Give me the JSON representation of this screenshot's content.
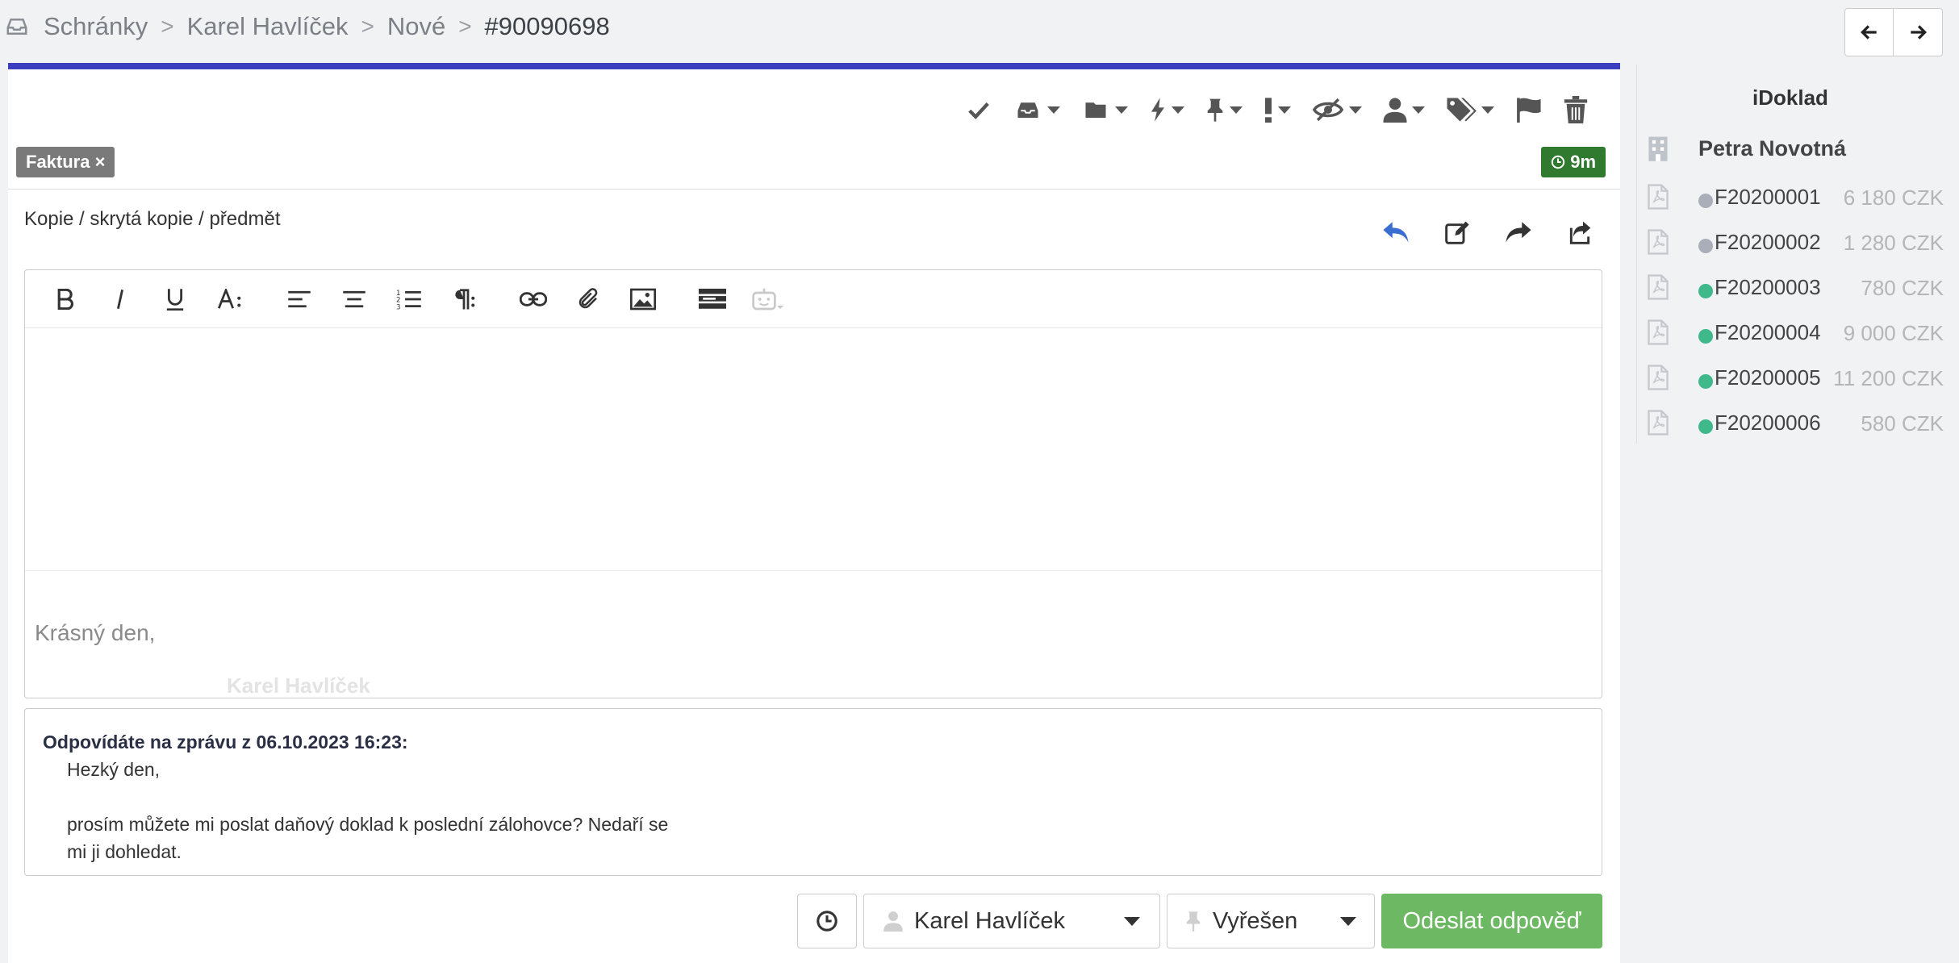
{
  "breadcrumb": {
    "items": [
      "Schránky",
      "Karel Havlíček",
      "Nové"
    ],
    "current": "#90090698"
  },
  "ticket": {
    "tag_label": "Faktura ×",
    "timer": "9m"
  },
  "toolbar_icons": [
    "check-icon",
    "inbox-icon",
    "folder-icon",
    "bolt-icon",
    "pin-icon",
    "exclamation-icon",
    "eye-slash-icon",
    "user-icon",
    "tags-icon",
    "flag-icon",
    "trash-icon"
  ],
  "compose": {
    "copy_link": "Kopie / skrytá kopie / předmět",
    "greeting": "Krásný den,",
    "signature_name": "Karel Havlíček"
  },
  "quote": {
    "header": "Odpovídáte na zprávu z 06.10.2023 16:23:",
    "body": "Hezký den,\n\nprosím můžete mi poslat daňový doklad k poslední zálohovce? Nedaří se\nmi ji dohledat."
  },
  "footer": {
    "assignee": "Karel Havlíček",
    "status": "Vyřešen",
    "send_label": "Odeslat odpověď"
  },
  "panel": {
    "title": "iDoklad",
    "contact": "Petra Novotná",
    "documents": [
      {
        "number": "F20200001",
        "amount": "6 180 CZK",
        "status_color": "#a9aeb8"
      },
      {
        "number": "F20200002",
        "amount": "1 280 CZK",
        "status_color": "#a9aeb8"
      },
      {
        "number": "F20200003",
        "amount": "780 CZK",
        "status_color": "#3fb88a"
      },
      {
        "number": "F20200004",
        "amount": "9 000 CZK",
        "status_color": "#3fb88a"
      },
      {
        "number": "F20200005",
        "amount": "11 200 CZK",
        "status_color": "#3fb88a"
      },
      {
        "number": "F20200006",
        "amount": "580 CZK",
        "status_color": "#3fb88a"
      }
    ]
  },
  "colors": {
    "accent_bar": "#3b3fbf",
    "send_button": "#6db862",
    "timer_badge": "#2f7a2f",
    "reply_icon": "#3a6fd1"
  }
}
